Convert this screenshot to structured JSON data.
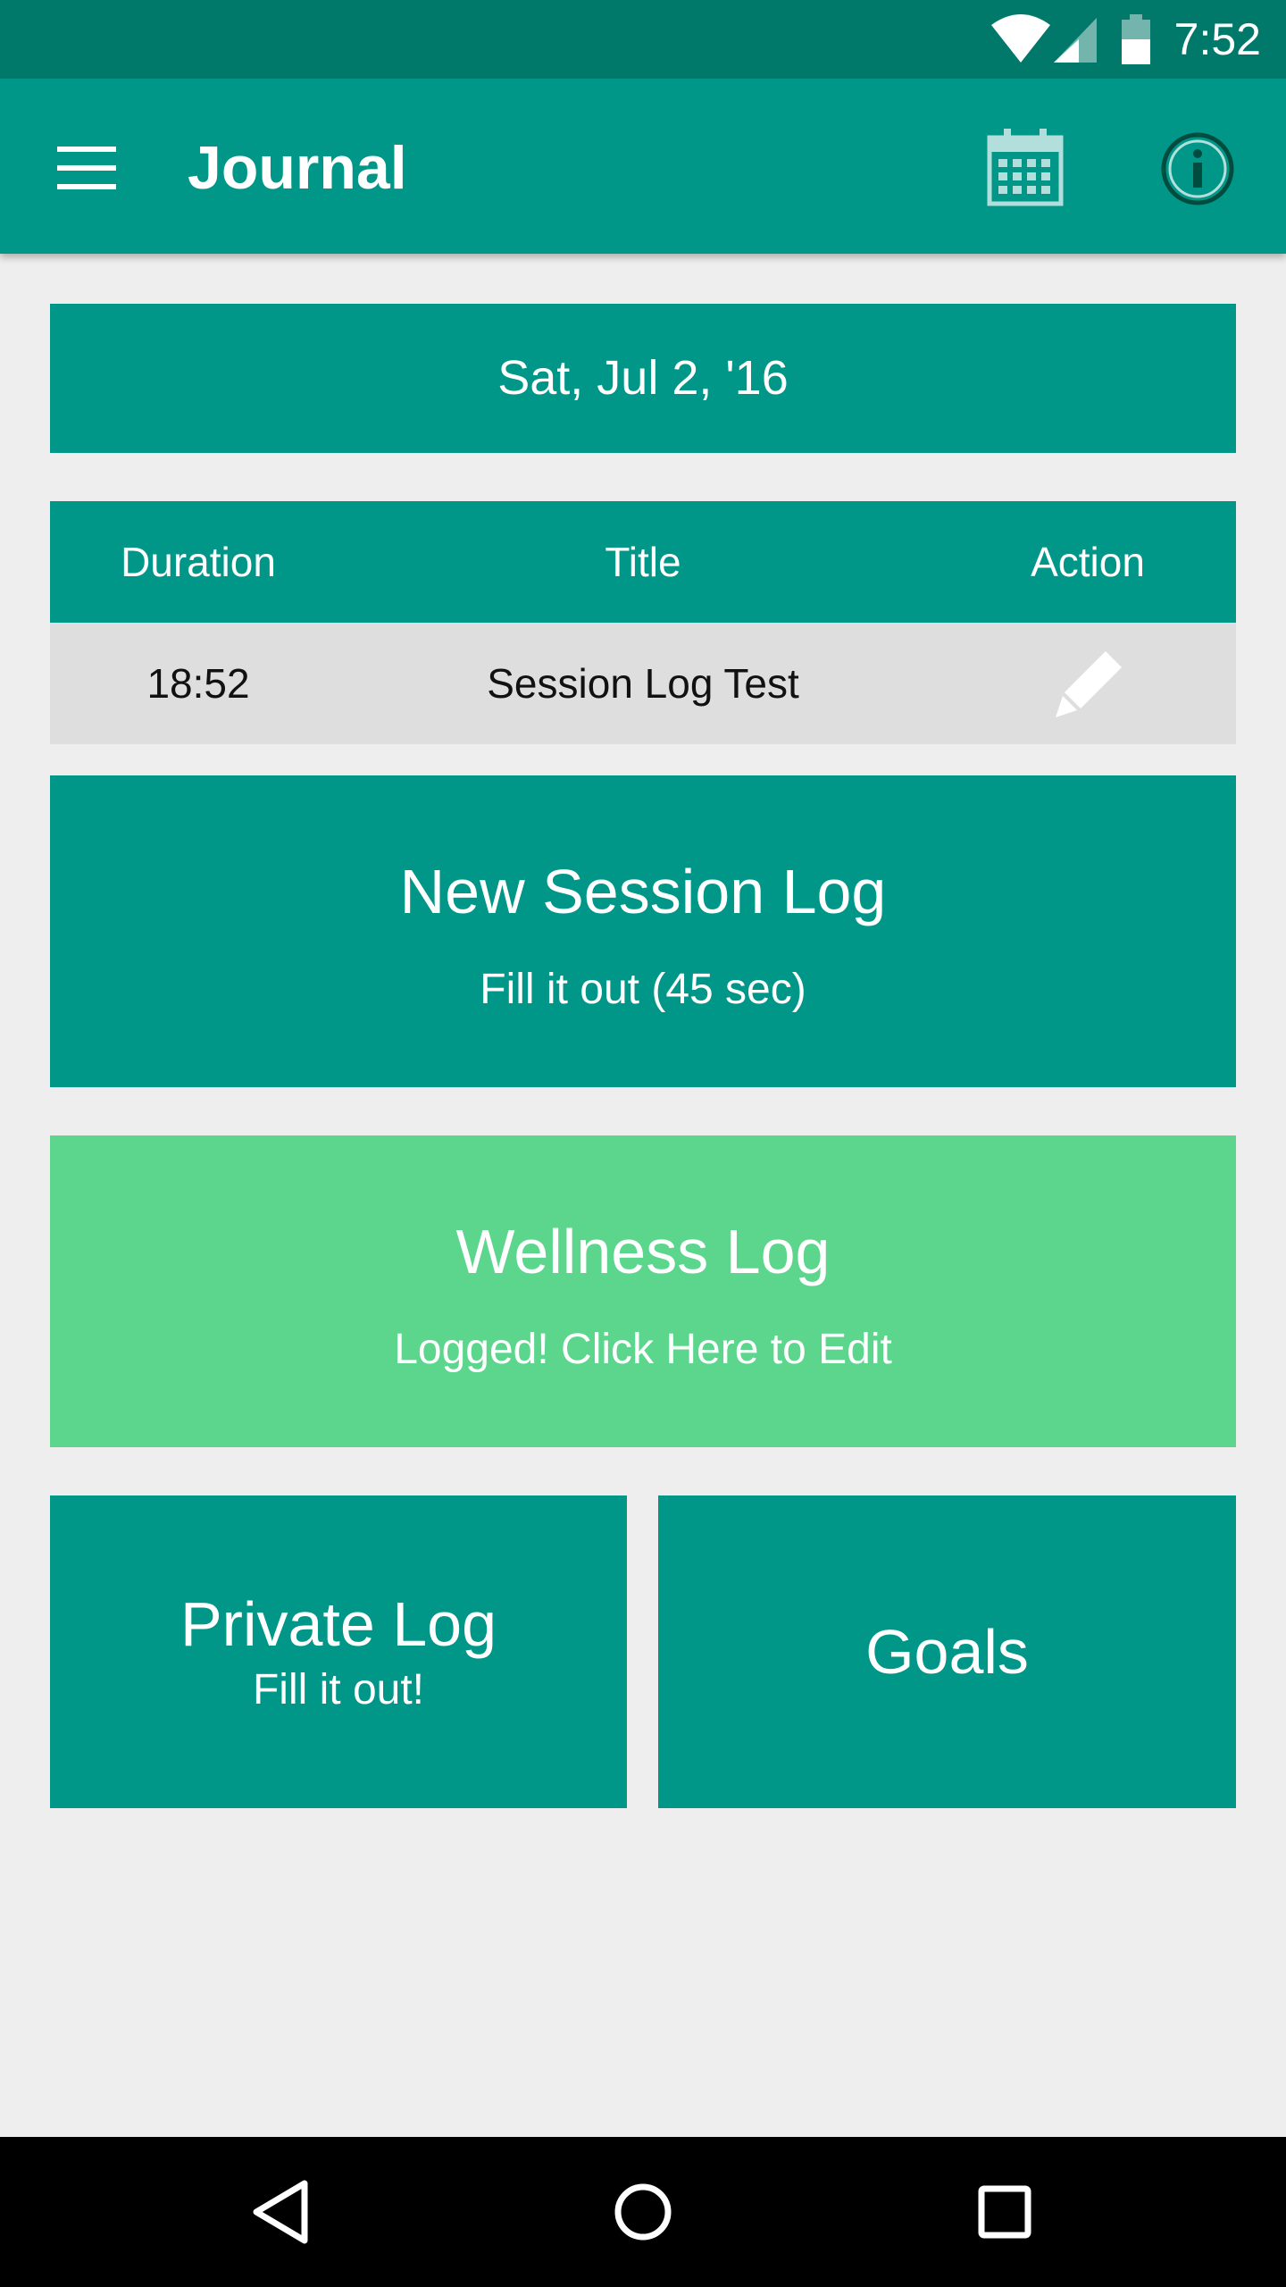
{
  "status_bar": {
    "time": "7:52",
    "icons": [
      "wifi-icon",
      "cell-signal-icon",
      "battery-icon"
    ]
  },
  "app_bar": {
    "title": "Journal",
    "icons": [
      "menu-icon",
      "calendar-icon",
      "info-icon"
    ]
  },
  "date_selector": {
    "label": "Sat, Jul 2, '16"
  },
  "session_table": {
    "columns": [
      "Duration",
      "Title",
      "Action"
    ],
    "rows": [
      {
        "duration": "18:52",
        "title": "Session Log Test",
        "action_icon": "pencil-icon"
      }
    ]
  },
  "new_session_card": {
    "title": "New Session Log",
    "subtitle": "Fill it out (45 sec)"
  },
  "wellness_card": {
    "title": "Wellness Log",
    "subtitle": "Logged! Click Here to Edit"
  },
  "private_log_card": {
    "title": "Private Log",
    "subtitle": "Fill it out!"
  },
  "goals_card": {
    "title": "Goals"
  },
  "nav_bar": {
    "icons": [
      "back-icon",
      "home-icon",
      "recents-icon"
    ]
  },
  "colors": {
    "status_bar": "#00796b",
    "primary": "#009688",
    "wellness_done": "#5cd68d",
    "background": "#eeeeee",
    "table_row": "#dedede"
  }
}
